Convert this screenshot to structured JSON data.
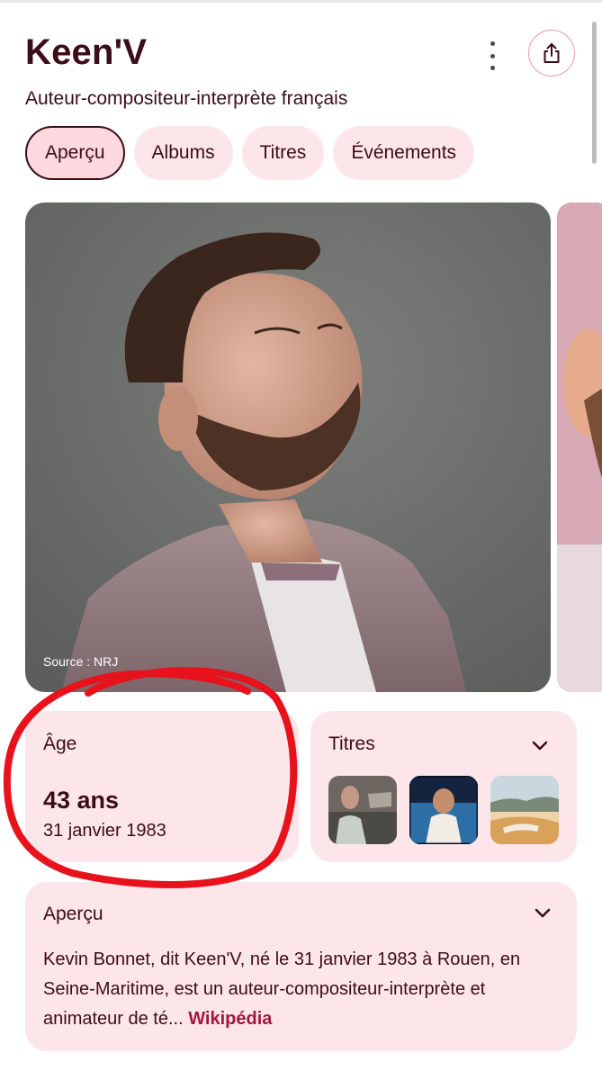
{
  "entity": {
    "title": "Keen'V",
    "subtitle": "Auteur-compositeur-interprète français"
  },
  "tabs": [
    {
      "label": "Aperçu",
      "active": true
    },
    {
      "label": "Albums"
    },
    {
      "label": "Titres"
    },
    {
      "label": "Événements"
    }
  ],
  "hero": {
    "source": "Source : NRJ"
  },
  "age_card": {
    "label": "Âge",
    "value": "43 ans",
    "birthdate": "31 janvier 1983"
  },
  "titres_card": {
    "label": "Titres"
  },
  "apercu_card": {
    "label": "Aperçu",
    "text": "Kevin Bonnet, dit Keen'V, né le 31 janvier 1983 à Rouen, en Seine-Maritime, est un auteur-compositeur-interprète et animateur de té...",
    "link": "Wikipédia"
  },
  "colors": {
    "text": "#3b0d17",
    "card_bg": "#fde6ea",
    "accent": "#a3173f",
    "annotation": "#e8121c"
  },
  "icons": [
    "more-vert-icon",
    "share-icon",
    "chevron-down-icon"
  ]
}
